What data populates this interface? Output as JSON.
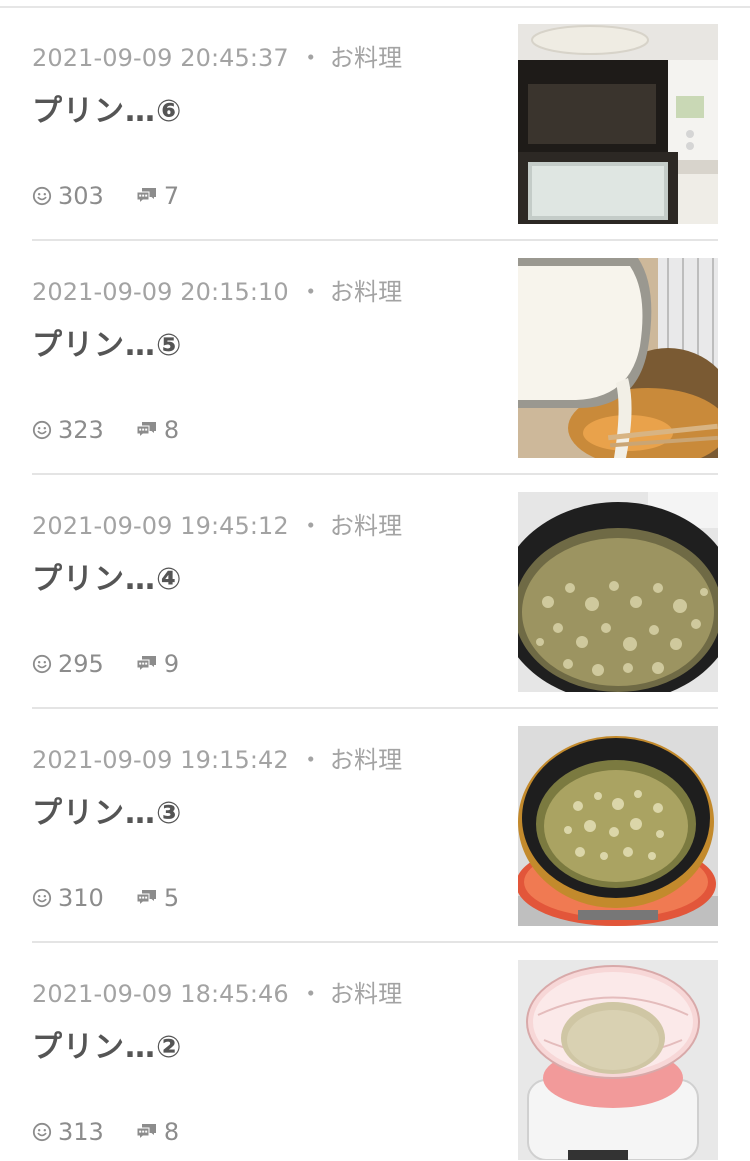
{
  "posts": [
    {
      "timestamp": "2021-09-09 20:45:37",
      "separator": "・",
      "category": "お料理",
      "title": "プリン…⑥",
      "likes": "303",
      "comments": "7",
      "thumbnail_icon": "oven-photo"
    },
    {
      "timestamp": "2021-09-09 20:15:10",
      "separator": "・",
      "category": "お料理",
      "title": "プリン…⑤",
      "likes": "323",
      "comments": "8",
      "thumbnail_icon": "pouring-milk-photo"
    },
    {
      "timestamp": "2021-09-09 19:45:12",
      "separator": "・",
      "category": "お料理",
      "title": "プリン…④",
      "likes": "295",
      "comments": "9",
      "thumbnail_icon": "bubbling-pan-photo"
    },
    {
      "timestamp": "2021-09-09 19:15:42",
      "separator": "・",
      "category": "お料理",
      "title": "プリン…③",
      "likes": "310",
      "comments": "5",
      "thumbnail_icon": "pan-on-stove-photo"
    },
    {
      "timestamp": "2021-09-09 18:45:46",
      "separator": "・",
      "category": "お料理",
      "title": "プリン…②",
      "likes": "313",
      "comments": "8",
      "thumbnail_icon": "sugar-bowl-scale-photo"
    }
  ],
  "colors": {
    "meta_text": "#a3a3a3",
    "title_text": "#555555",
    "stat_text": "#8c8c8c",
    "divider": "#e4e4e4"
  }
}
